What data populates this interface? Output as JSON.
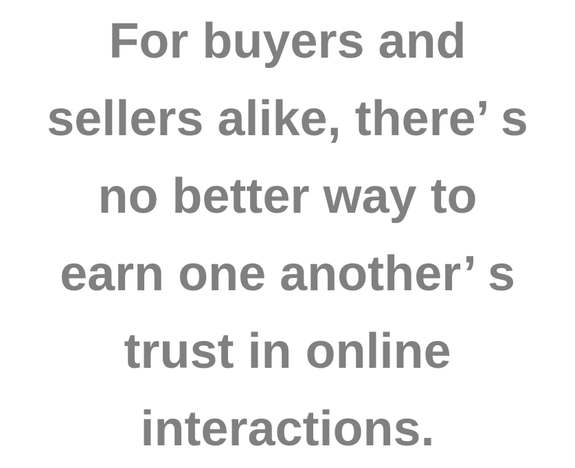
{
  "quote": {
    "lines": [
      "For buyers and",
      "sellers alike, there’ s",
      "no better way to",
      "earn one another’ s",
      "trust in online",
      "interactions."
    ]
  },
  "colors": {
    "text": "#808080",
    "background": "#ffffff"
  }
}
